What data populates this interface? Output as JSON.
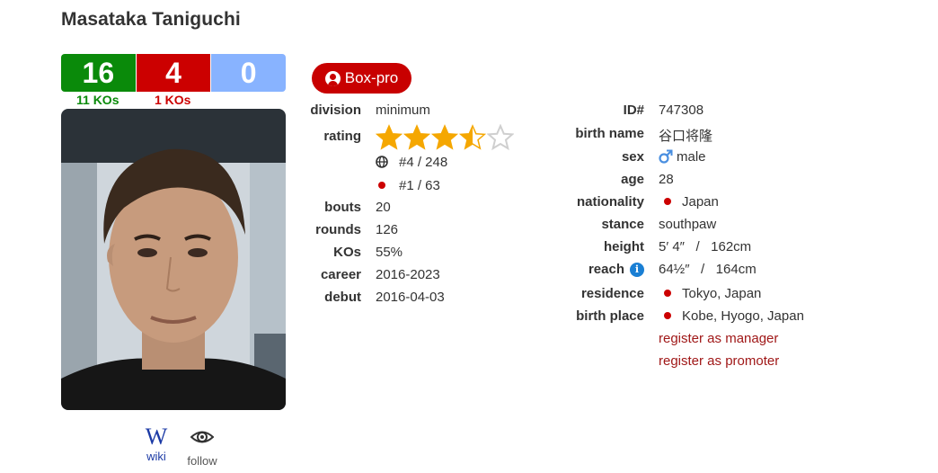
{
  "boxer": {
    "name": "Masataka Taniguchi",
    "record": {
      "wins": "16",
      "losses": "4",
      "draws": "0",
      "win_kos": "11 KOs",
      "loss_kos": "1 KOs"
    },
    "badge": "Box-pro"
  },
  "links": {
    "wiki_glyph": "W",
    "wiki_label": "wiki",
    "follow_label": "follow"
  },
  "stats": {
    "division_label": "division",
    "division": "minimum",
    "rating_label": "rating",
    "rating_stars": 3.5,
    "rating_max": 5,
    "world_rank": "#4 / 248",
    "country_rank": "#1 / 63",
    "bouts_label": "bouts",
    "bouts": "20",
    "rounds_label": "rounds",
    "rounds": "126",
    "kos_label": "KOs",
    "kos": "55%",
    "career_label": "career",
    "career": "2016-2023",
    "debut_label": "debut",
    "debut": "2016-04-03"
  },
  "bio": {
    "id_label": "ID#",
    "id": "747308",
    "birth_name_label": "birth name",
    "birth_name": "谷口将隆",
    "sex_label": "sex",
    "sex": "male",
    "age_label": "age",
    "age": "28",
    "nationality_label": "nationality",
    "nationality": "Japan",
    "stance_label": "stance",
    "stance": "southpaw",
    "height_label": "height",
    "height": "5′ 4″   /   162cm",
    "reach_label": "reach",
    "reach_info": "i",
    "reach": "64½″   /   164cm",
    "residence_label": "residence",
    "residence": "Tokyo, Japan",
    "birth_place_label": "birth place",
    "birth_place": "Kobe, Hyogo, Japan",
    "register_manager": "register as manager",
    "register_promoter": "register as promoter"
  },
  "colors": {
    "win": "#0a8a0a",
    "loss": "#cc0000",
    "draw": "#88b3ff",
    "badge": "#c80000",
    "star": "#f5a700",
    "link": "#a01818"
  },
  "icons": [
    "user-icon",
    "globe-icon",
    "star-icon",
    "male-icon",
    "info-icon",
    "wikipedia-icon",
    "eye-icon",
    "japan-flag-icon"
  ]
}
